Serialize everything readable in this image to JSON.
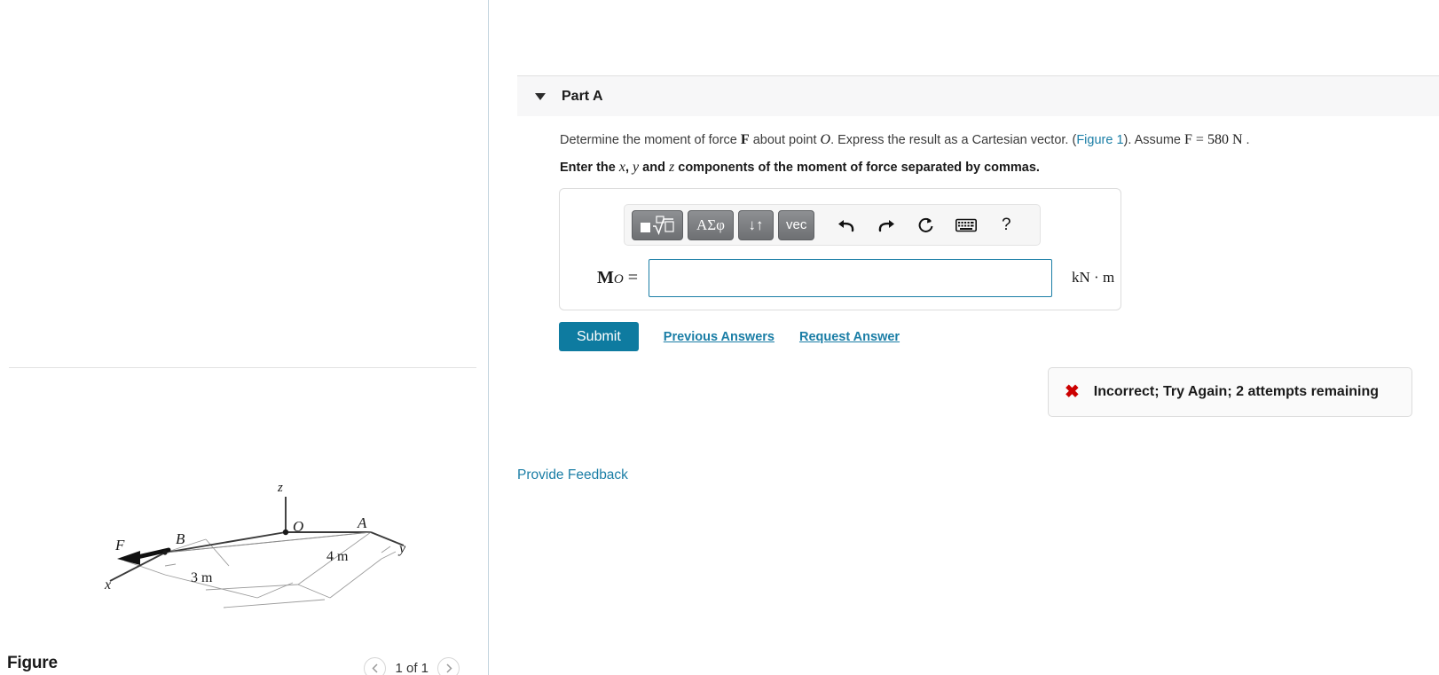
{
  "figure_panel": {
    "title": "Figure",
    "pager": {
      "prev_icon": "chevron-left-icon",
      "label": "1 of 1",
      "next_icon": "chevron-right-icon"
    },
    "diagram": {
      "labels": {
        "z_axis": "z",
        "y_axis": "y",
        "x_axis": "x",
        "origin": "O",
        "point_a": "A",
        "point_b": "B",
        "force": "F",
        "dim_3m": "3 m",
        "dim_4m": "4 m"
      }
    }
  },
  "part": {
    "caret_icon": "caret-down-icon",
    "title": "Part A",
    "question": {
      "seg1": "Determine the moment of force ",
      "force_symbol": "F",
      "seg2": " about point ",
      "point_symbol": "O",
      "seg3": ". Express the result as a Cartesian vector. (",
      "figure_link": "Figure 1",
      "seg4": "). Assume ",
      "assume_expr": "F = 580 N",
      "seg5": " ."
    },
    "instruction": {
      "seg1": "Enter the ",
      "x": "x",
      "seg2": ", ",
      "y": "y",
      "seg3": " and ",
      "z": "z",
      "seg4": " components of the moment of force separated by commas."
    }
  },
  "math_toolbar": {
    "buttons": [
      {
        "name": "template-radical-button",
        "label": "■√□",
        "icon": "template-radical-icon"
      },
      {
        "name": "greek-symbols-button",
        "label": "ΑΣφ",
        "icon": "greek-letters-icon"
      },
      {
        "name": "sort-arrows-button",
        "label": "↓↑",
        "icon": "up-down-arrows-icon"
      },
      {
        "name": "vector-button",
        "label": "vec",
        "icon": "vector-icon"
      }
    ],
    "icons": [
      {
        "name": "undo-button",
        "glyph": "↶",
        "icon": "undo-icon"
      },
      {
        "name": "redo-button",
        "glyph": "↷",
        "icon": "redo-icon"
      },
      {
        "name": "reset-button",
        "glyph": "↺",
        "icon": "reset-icon"
      },
      {
        "name": "keyboard-button",
        "glyph": "⌨",
        "icon": "keyboard-icon"
      },
      {
        "name": "help-button",
        "glyph": "?",
        "icon": "question-mark-icon"
      }
    ]
  },
  "answer": {
    "label_main": "M",
    "label_sub": "O",
    "label_equals": " =",
    "value": "",
    "placeholder": "",
    "units": "kN · m"
  },
  "actions": {
    "submit_label": "Submit",
    "previous_answers_label": "Previous Answers",
    "request_answer_label": "Request Answer"
  },
  "feedback": {
    "icon": "red-x-icon",
    "glyph": "✖",
    "message": "Incorrect; Try Again; 2 attempts remaining",
    "color": "#cc0000"
  },
  "footer": {
    "provide_feedback_label": "Provide Feedback"
  },
  "colors": {
    "accent": "#1b7ea6",
    "submit": "#0e7ba0",
    "error": "#cc0000",
    "header_bg": "#f7f7f8"
  }
}
